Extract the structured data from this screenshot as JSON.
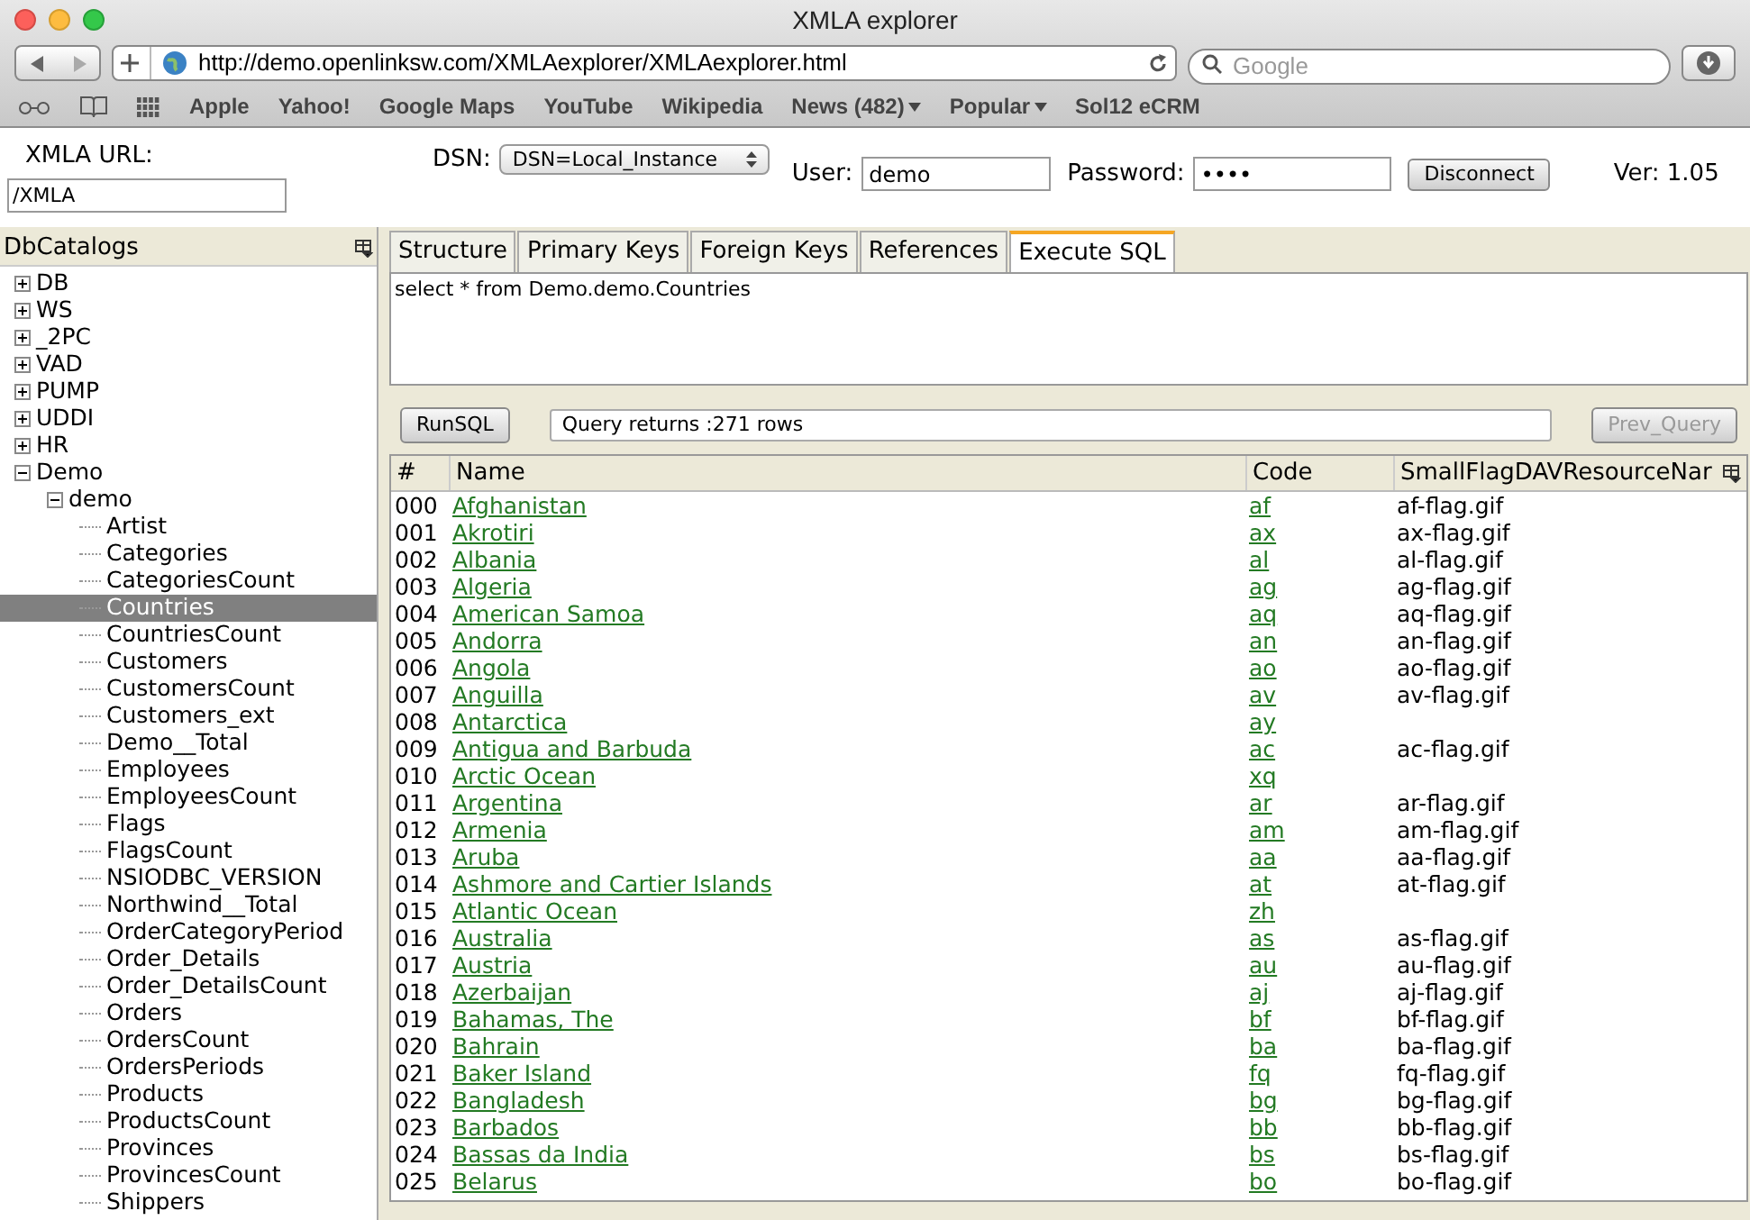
{
  "window": {
    "title": "XMLA explorer"
  },
  "browser": {
    "url": "http://demo.openlinksw.com/XMLAexplorer/XMLAexplorer.html",
    "search_placeholder": "Google",
    "bookmarks": [
      {
        "label": "Apple",
        "menu": false
      },
      {
        "label": "Yahoo!",
        "menu": false
      },
      {
        "label": "Google Maps",
        "menu": false
      },
      {
        "label": "YouTube",
        "menu": false
      },
      {
        "label": "Wikipedia",
        "menu": false
      },
      {
        "label": "News (482)",
        "menu": true
      },
      {
        "label": "Popular",
        "menu": true
      },
      {
        "label": "Sol12 eCRM",
        "menu": false
      }
    ]
  },
  "connection": {
    "xmla_url_label": "XMLA URL:",
    "xmla_url": "/XMLA",
    "dsn_label": "DSN:",
    "dsn": "DSN=Local_Instance",
    "user_label": "User:",
    "user": "demo",
    "password_label": "Password:",
    "password": "••••",
    "disconnect": "Disconnect",
    "version": "Ver: 1.05"
  },
  "sidebar": {
    "title": "DbCatalogs",
    "items": [
      {
        "label": "DB",
        "expanded": false,
        "selected": false
      },
      {
        "label": "WS",
        "expanded": false,
        "selected": false
      },
      {
        "label": "_2PC",
        "expanded": false,
        "selected": false
      },
      {
        "label": "VAD",
        "expanded": false,
        "selected": false
      },
      {
        "label": "PUMP",
        "expanded": false,
        "selected": false
      },
      {
        "label": "UDDI",
        "expanded": false,
        "selected": false
      },
      {
        "label": "HR",
        "expanded": false,
        "selected": false
      },
      {
        "label": "Demo",
        "expanded": true,
        "selected": false,
        "children": [
          {
            "label": "demo",
            "expanded": true,
            "selected": false,
            "children": [
              {
                "label": "Artist",
                "selected": false
              },
              {
                "label": "Categories",
                "selected": false
              },
              {
                "label": "CategoriesCount",
                "selected": false
              },
              {
                "label": "Countries",
                "selected": true
              },
              {
                "label": "CountriesCount",
                "selected": false
              },
              {
                "label": "Customers",
                "selected": false
              },
              {
                "label": "CustomersCount",
                "selected": false
              },
              {
                "label": "Customers_ext",
                "selected": false
              },
              {
                "label": "Demo__Total",
                "selected": false
              },
              {
                "label": "Employees",
                "selected": false
              },
              {
                "label": "EmployeesCount",
                "selected": false
              },
              {
                "label": "Flags",
                "selected": false
              },
              {
                "label": "FlagsCount",
                "selected": false
              },
              {
                "label": "NSIODBC_VERSION",
                "selected": false
              },
              {
                "label": "Northwind__Total",
                "selected": false
              },
              {
                "label": "OrderCategoryPeriod",
                "selected": false
              },
              {
                "label": "Order_Details",
                "selected": false
              },
              {
                "label": "Order_DetailsCount",
                "selected": false
              },
              {
                "label": "Orders",
                "selected": false
              },
              {
                "label": "OrdersCount",
                "selected": false
              },
              {
                "label": "OrdersPeriods",
                "selected": false
              },
              {
                "label": "Products",
                "selected": false
              },
              {
                "label": "ProductsCount",
                "selected": false
              },
              {
                "label": "Provinces",
                "selected": false
              },
              {
                "label": "ProvincesCount",
                "selected": false
              },
              {
                "label": "Shippers",
                "selected": false
              }
            ]
          }
        ]
      }
    ]
  },
  "tabs": [
    {
      "label": "Structure",
      "selected": false
    },
    {
      "label": "Primary Keys",
      "selected": false
    },
    {
      "label": "Foreign Keys",
      "selected": false
    },
    {
      "label": "References",
      "selected": false
    },
    {
      "label": "Execute SQL",
      "selected": true
    }
  ],
  "query": {
    "sql": "select * from Demo.demo.Countries",
    "run": "RunSQL",
    "status": "Query returns :271 rows",
    "prev": "Prev_Query",
    "prev_disabled": true
  },
  "table": {
    "columns": [
      "#",
      "Name",
      "Code",
      "SmallFlagDAVResourceNar"
    ],
    "rows": [
      {
        "num": "000",
        "name": "Afghanistan",
        "code": "af",
        "flag": "af-flag.gif"
      },
      {
        "num": "001",
        "name": "Akrotiri",
        "code": "ax",
        "flag": "ax-flag.gif"
      },
      {
        "num": "002",
        "name": "Albania",
        "code": "al",
        "flag": "al-flag.gif"
      },
      {
        "num": "003",
        "name": "Algeria",
        "code": "ag",
        "flag": "ag-flag.gif"
      },
      {
        "num": "004",
        "name": "American Samoa",
        "code": "aq",
        "flag": "aq-flag.gif"
      },
      {
        "num": "005",
        "name": "Andorra",
        "code": "an",
        "flag": "an-flag.gif"
      },
      {
        "num": "006",
        "name": "Angola",
        "code": "ao",
        "flag": "ao-flag.gif"
      },
      {
        "num": "007",
        "name": "Anguilla",
        "code": "av",
        "flag": "av-flag.gif"
      },
      {
        "num": "008",
        "name": "Antarctica",
        "code": "ay"
      },
      {
        "num": "009",
        "name": "Antigua and Barbuda",
        "code": "ac",
        "flag": "ac-flag.gif"
      },
      {
        "num": "010",
        "name": "Arctic Ocean",
        "code": "xq"
      },
      {
        "num": "011",
        "name": "Argentina",
        "code": "ar",
        "flag": "ar-flag.gif"
      },
      {
        "num": "012",
        "name": "Armenia",
        "code": "am",
        "flag": "am-flag.gif"
      },
      {
        "num": "013",
        "name": "Aruba",
        "code": "aa",
        "flag": "aa-flag.gif"
      },
      {
        "num": "014",
        "name": "Ashmore and Cartier Islands",
        "code": "at",
        "flag": "at-flag.gif"
      },
      {
        "num": "015",
        "name": "Atlantic Ocean",
        "code": "zh"
      },
      {
        "num": "016",
        "name": "Australia",
        "code": "as",
        "flag": "as-flag.gif"
      },
      {
        "num": "017",
        "name": "Austria",
        "code": "au",
        "flag": "au-flag.gif"
      },
      {
        "num": "018",
        "name": "Azerbaijan",
        "code": "aj",
        "flag": "aj-flag.gif"
      },
      {
        "num": "019",
        "name": "Bahamas, The",
        "code": "bf",
        "flag": "bf-flag.gif"
      },
      {
        "num": "020",
        "name": "Bahrain",
        "code": "ba",
        "flag": "ba-flag.gif"
      },
      {
        "num": "021",
        "name": "Baker Island",
        "code": "fq",
        "flag": "fq-flag.gif"
      },
      {
        "num": "022",
        "name": "Bangladesh",
        "code": "bg",
        "flag": "bg-flag.gif"
      },
      {
        "num": "023",
        "name": "Barbados",
        "code": "bb",
        "flag": "bb-flag.gif"
      },
      {
        "num": "024",
        "name": "Bassas da India",
        "code": "bs",
        "flag": "bs-flag.gif"
      },
      {
        "num": "025",
        "name": "Belarus",
        "code": "bo",
        "flag": "bo-flag.gif"
      }
    ]
  }
}
